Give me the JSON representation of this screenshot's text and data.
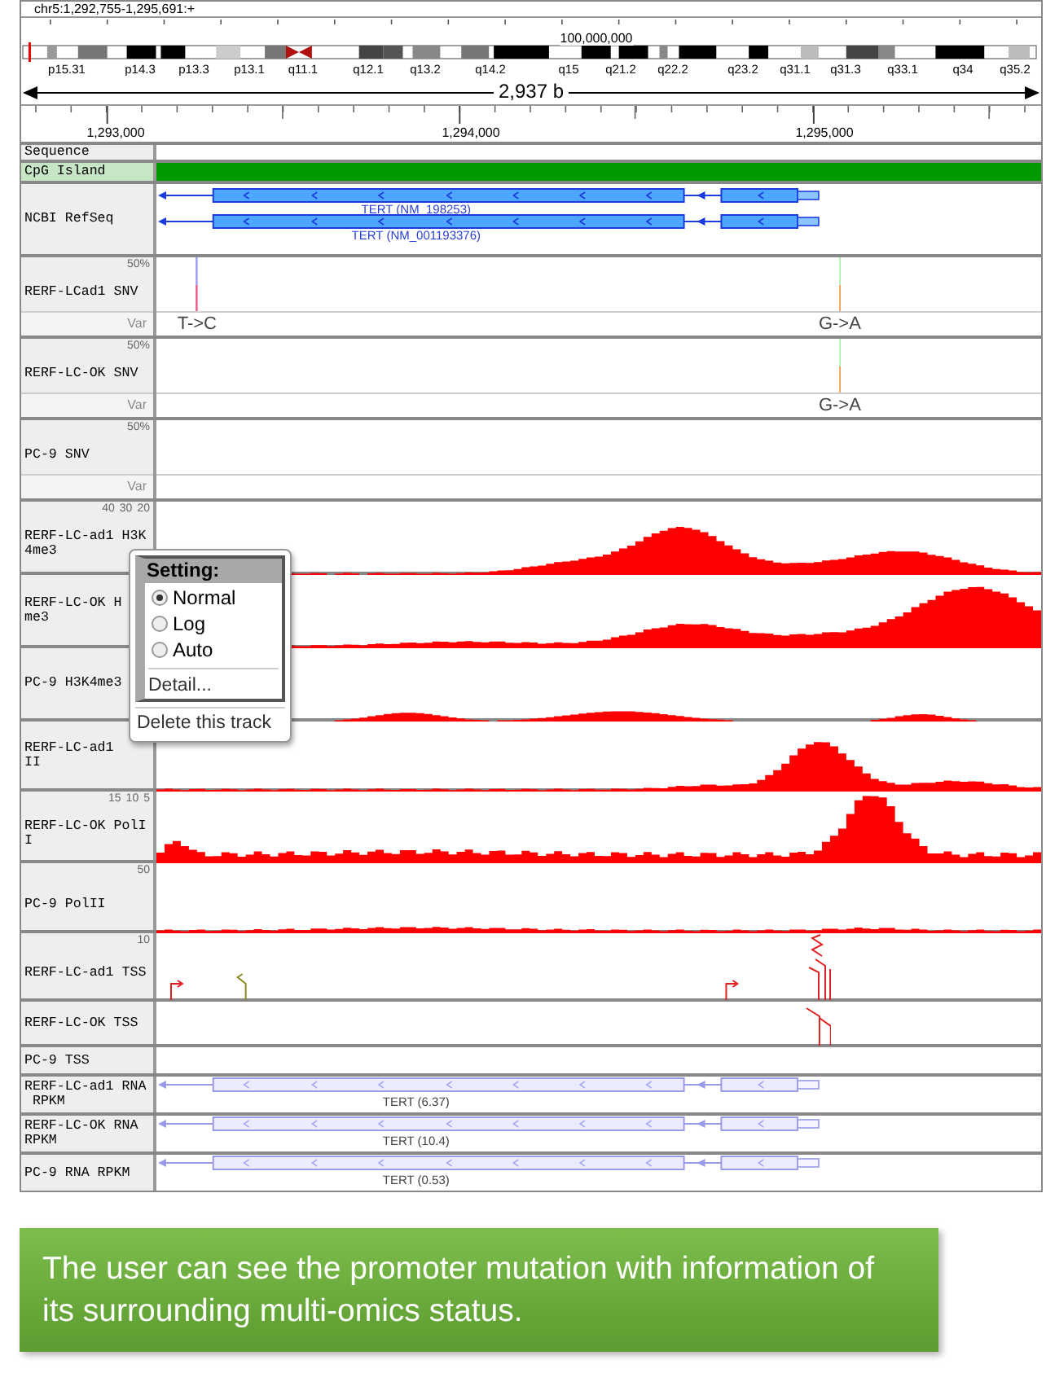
{
  "location": "chr5:1,292,755-1,295,691:+",
  "ideogram": {
    "position_label": "100,000,000",
    "bands": [
      "p15.31",
      "p14.3",
      "p13.3",
      "p13.1",
      "q11.1",
      "q12.1",
      "q13.2",
      "q14.2",
      "q15",
      "q21.2",
      "q22.2",
      "q23.2",
      "q31.1",
      "q31.3",
      "q33.1",
      "q34",
      "q35.2"
    ]
  },
  "span": "2,937 b",
  "ruler": [
    "1,293,000",
    "1,294,000",
    "1,295,000"
  ],
  "tracks": [
    {
      "kind": "sequence",
      "label": "Sequence"
    },
    {
      "kind": "cpg",
      "label": "CpG Island"
    },
    {
      "kind": "refseq",
      "label": "NCBI RefSeq",
      "transcripts": [
        "TERT (NM_198253)",
        "TERT (NM_001193376)"
      ]
    },
    {
      "kind": "snv",
      "label": "RERF-LCad1 SNV",
      "axis": [
        "50%"
      ],
      "sublabel": "Var",
      "variants": [
        "T->C",
        "G->A"
      ]
    },
    {
      "kind": "snv",
      "label": "RERF-LC-OK SNV",
      "axis": [
        "50%"
      ],
      "sublabel": "Var",
      "variants": [
        "G->A"
      ]
    },
    {
      "kind": "snv",
      "label": "PC-9 SNV",
      "axis": [
        "50%"
      ],
      "sublabel": "Var"
    },
    {
      "kind": "signal",
      "label": "RERF-LC-ad1 H3K\n4me3",
      "axis": [
        "40",
        "30",
        "20"
      ]
    },
    {
      "kind": "signal",
      "label": "RERF-LC-OK H\nme3"
    },
    {
      "kind": "signal",
      "label": "PC-9 H3K4me3"
    },
    {
      "kind": "signal",
      "label": "RERF-LC-ad1\nII"
    },
    {
      "kind": "signal",
      "label": "RERF-LC-OK PolI\nI",
      "axis": [
        "15",
        "10",
        "5"
      ]
    },
    {
      "kind": "signal",
      "label": "PC-9 PolII",
      "axis": [
        "50"
      ]
    },
    {
      "kind": "tss",
      "label": "RERF-LC-ad1 TSS",
      "axis": [
        "10"
      ]
    },
    {
      "kind": "tss",
      "label": "RERF-LC-OK TSS"
    },
    {
      "kind": "tss",
      "label": "PC-9 TSS"
    },
    {
      "kind": "rna",
      "label": "RERF-LC-ad1 RNA\n RPKM",
      "gene": "TERT (6.37)"
    },
    {
      "kind": "rna",
      "label": "RERF-LC-OK RNA\nRPKM",
      "gene": "TERT (10.4)"
    },
    {
      "kind": "rna",
      "label": "PC-9 RNA RPKM",
      "gene": "TERT (0.53)"
    }
  ],
  "popup": {
    "title": "Setting:",
    "options": [
      {
        "label": "Normal",
        "selected": true
      },
      {
        "label": "Log",
        "selected": false
      },
      {
        "label": "Auto",
        "selected": false
      }
    ],
    "detail": "Detail...",
    "delete": "Delete this track"
  },
  "caption": "The user can see the promoter mutation with information of its surrounding multi-omics status."
}
